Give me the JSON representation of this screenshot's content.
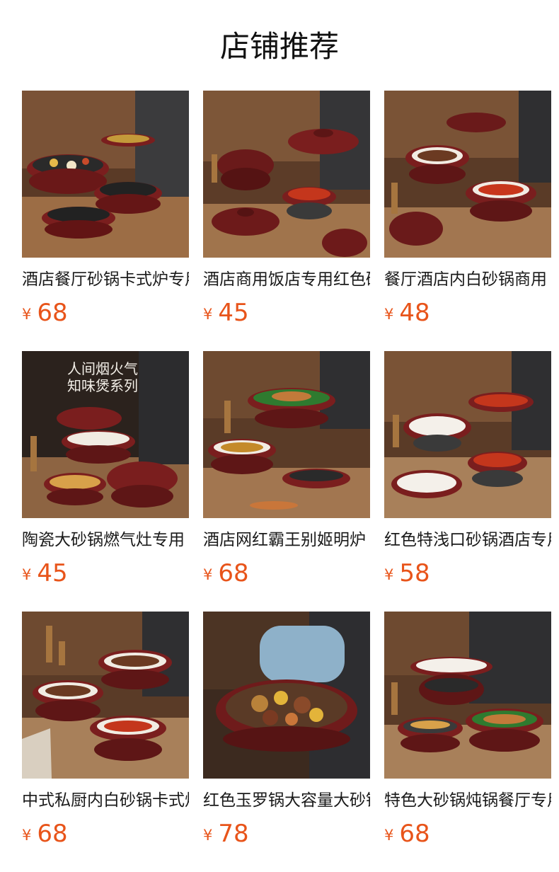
{
  "page_title": "店铺推荐",
  "products": [
    {
      "name": "酒店餐厅砂锅卡式炉专用",
      "currency": "¥",
      "price": "68"
    },
    {
      "name": "酒店商用饭店专用红色砂锅",
      "currency": "¥",
      "price": "45"
    },
    {
      "name": "餐厅酒店内白砂锅商用",
      "currency": "¥",
      "price": "48"
    },
    {
      "name": "陶瓷大砂锅燃气灶专用",
      "currency": "¥",
      "price": "45"
    },
    {
      "name": "酒店网红霸王别姬明炉",
      "currency": "¥",
      "price": "68"
    },
    {
      "name": "红色特浅口砂锅酒店专用",
      "currency": "¥",
      "price": "58"
    },
    {
      "name": "中式私厨内白砂锅卡式炉",
      "currency": "¥",
      "price": "68"
    },
    {
      "name": "红色玉罗锅大容量大砂锅",
      "currency": "¥",
      "price": "78"
    },
    {
      "name": "特色大砂锅炖锅餐厅专用",
      "currency": "¥",
      "price": "68"
    }
  ],
  "image_overlay": {
    "line1": "人间烟火气",
    "line2": "知味煲系列"
  }
}
